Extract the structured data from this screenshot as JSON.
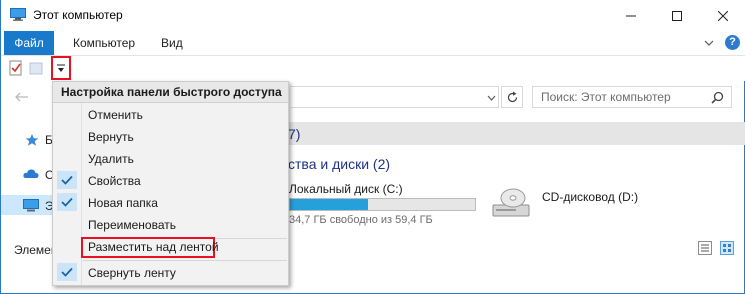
{
  "window": {
    "title": "Этот компьютер"
  },
  "ribbon": {
    "tabs": [
      "Файл",
      "Компьютер",
      "Вид"
    ]
  },
  "search": {
    "placeholder": "Поиск: Этот компьютер"
  },
  "navigation": {
    "items": [
      "Б",
      "О",
      "Э"
    ]
  },
  "content": {
    "folders_group_count": "7)",
    "drives_group_label": "ства и диски (2)",
    "drives": [
      {
        "name": "Локальный диск (C:)",
        "space_text": "34,7 ГБ свободно из 59,4 ГБ",
        "used_fraction": 0.42
      },
      {
        "name": "CD-дисковод (D:)"
      }
    ]
  },
  "status": {
    "elements_label": "Элемен"
  },
  "qat_menu": {
    "header": "Настройка панели быстрого доступа",
    "items": [
      {
        "label": "Отменить",
        "checked": false
      },
      {
        "label": "Вернуть",
        "checked": false
      },
      {
        "label": "Удалить",
        "checked": false
      },
      {
        "label": "Свойства",
        "checked": true
      },
      {
        "label": "Новая папка",
        "checked": true
      },
      {
        "label": "Переименовать",
        "checked": false
      },
      {
        "label": "Разместить над лентой",
        "checked": false
      },
      {
        "label": "Свернуть ленту",
        "checked": true
      }
    ]
  },
  "colors": {
    "accent": "#1979ca",
    "highlight": "#e81123",
    "check_bg": "#cce4f7",
    "check_color": "#1a64a8"
  }
}
